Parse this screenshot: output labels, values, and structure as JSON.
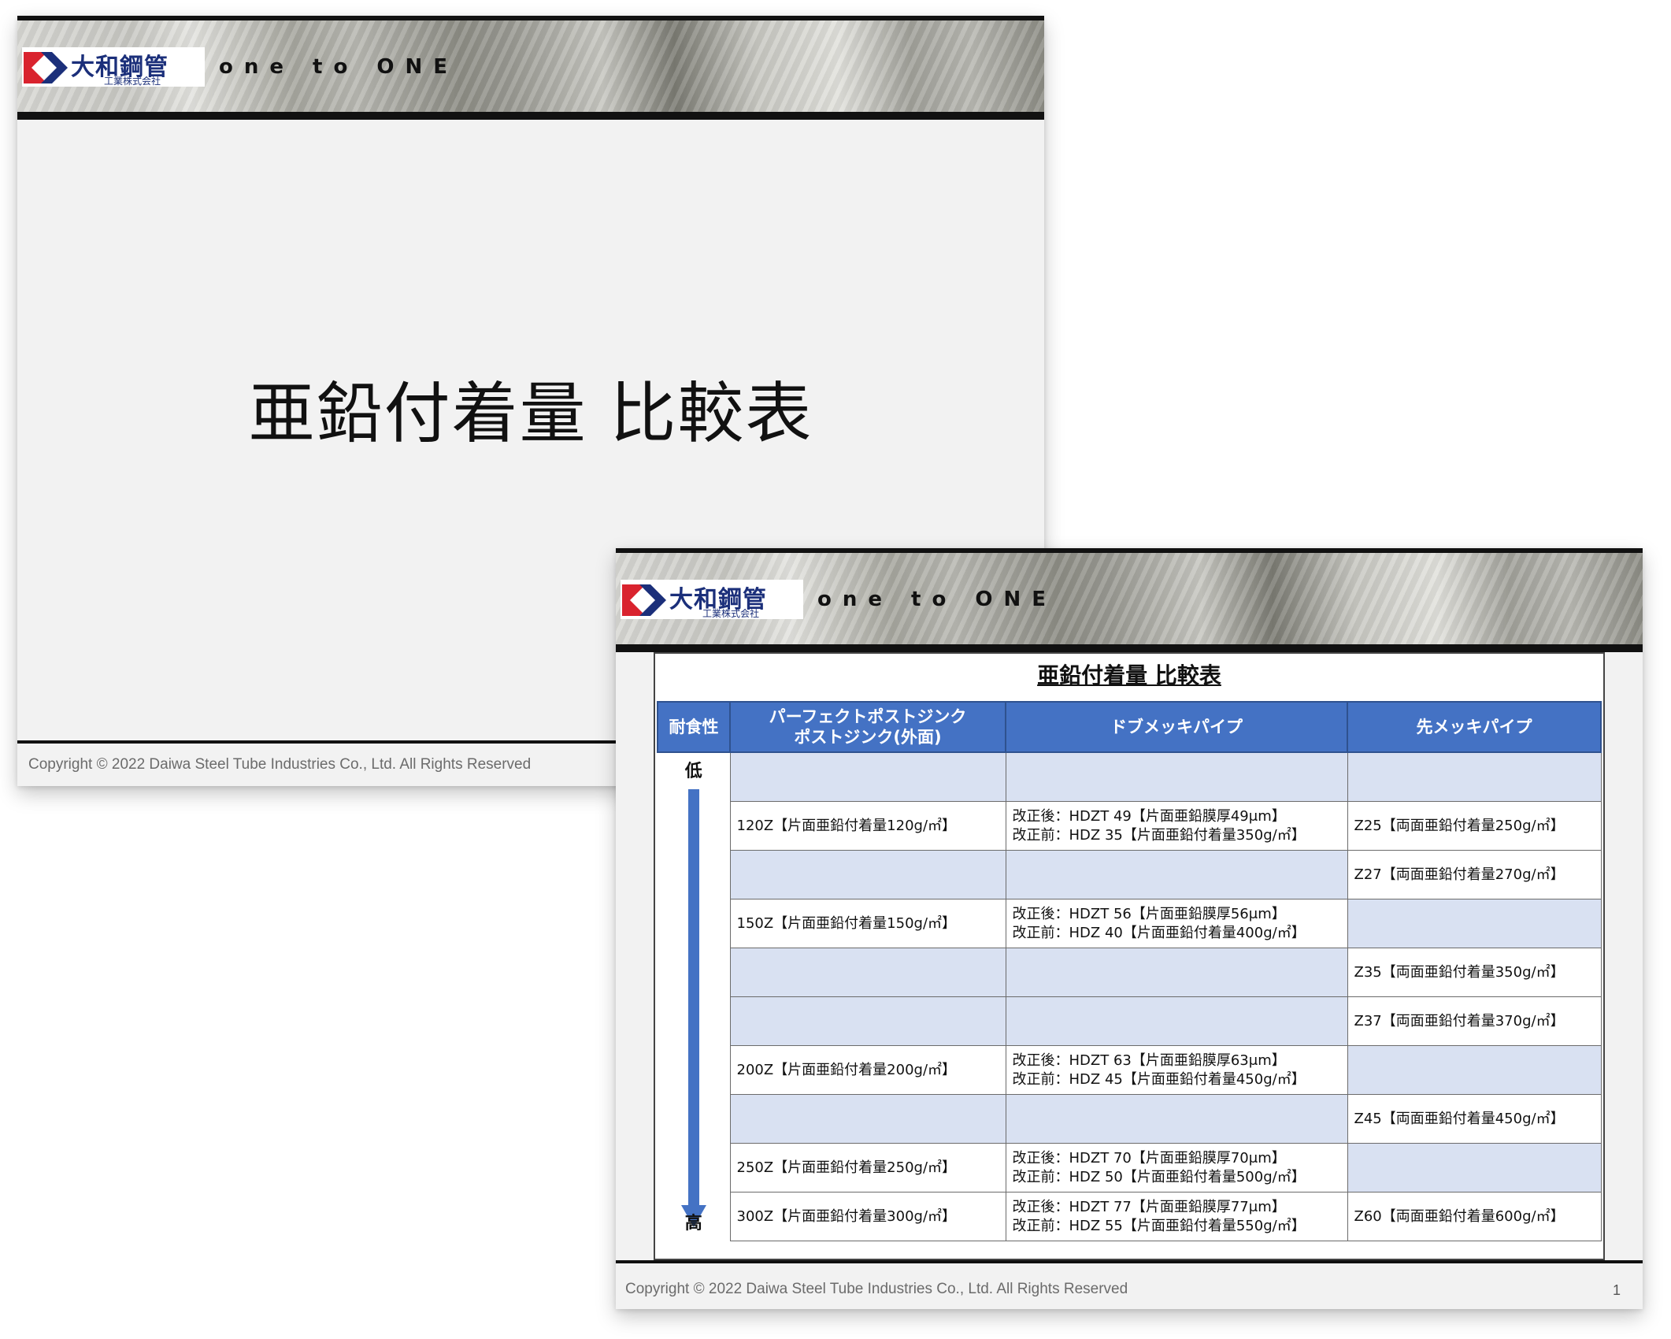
{
  "brand": {
    "company": "大和鋼管",
    "company_sub": "工業株式会社",
    "tagline": "one to ONE",
    "colors": {
      "logo_navy": "#1b2f7a",
      "logo_red": "#d9232e",
      "header_blue": "#4472c4",
      "empty_cell": "#d9e1f2"
    }
  },
  "title_slide": {
    "title": "亜鉛付着量 比較表",
    "copyright": "Copyright © 2022 Daiwa Steel Tube Industries Co., Ltd. All Rights Reserved"
  },
  "table_slide": {
    "title": "亜鉛付着量 比較表",
    "copyright": "Copyright © 2022 Daiwa Steel Tube Industries Co., Ltd. All Rights Reserved",
    "page_number": "1",
    "axis": {
      "header": "耐食性",
      "low": "低",
      "high": "高",
      "icon": "down-arrow-icon"
    },
    "columns": [
      {
        "line1": "パーフェクトポストジンク",
        "line2": "ポストジンク(外面)"
      },
      {
        "line1": "ドブメッキパイプ",
        "line2": ""
      },
      {
        "line1": "先メッキパイプ",
        "line2": ""
      }
    ],
    "rows": [
      [
        "",
        "",
        ""
      ],
      [
        "120Z【片面亜鉛付着量120g/㎡】",
        "改正後：HDZT 49【片面亜鉛膜厚49μm】\n改正前：HDZ 35【片面亜鉛付着量350g/㎡】",
        "Z25【両面亜鉛付着量250g/㎡】"
      ],
      [
        "",
        "",
        "Z27【両面亜鉛付着量270g/㎡】"
      ],
      [
        "150Z【片面亜鉛付着量150g/㎡】",
        "改正後：HDZT 56【片面亜鉛膜厚56μm】\n改正前：HDZ 40【片面亜鉛付着量400g/㎡】",
        ""
      ],
      [
        "",
        "",
        "Z35【両面亜鉛付着量350g/㎡】"
      ],
      [
        "",
        "",
        "Z37【両面亜鉛付着量370g/㎡】"
      ],
      [
        "200Z【片面亜鉛付着量200g/㎡】",
        "改正後：HDZT 63【片面亜鉛膜厚63μm】\n改正前：HDZ 45【片面亜鉛付着量450g/㎡】",
        ""
      ],
      [
        "",
        "",
        "Z45【両面亜鉛付着量450g/㎡】"
      ],
      [
        "250Z【片面亜鉛付着量250g/㎡】",
        "改正後：HDZT 70【片面亜鉛膜厚70μm】\n改正前：HDZ 50【片面亜鉛付着量500g/㎡】",
        ""
      ],
      [
        "300Z【片面亜鉛付着量300g/㎡】",
        "改正後：HDZT 77【片面亜鉛膜厚77μm】\n改正前：HDZ 55【片面亜鉛付着量550g/㎡】",
        "Z60【両面亜鉛付着量600g/㎡】"
      ]
    ]
  }
}
